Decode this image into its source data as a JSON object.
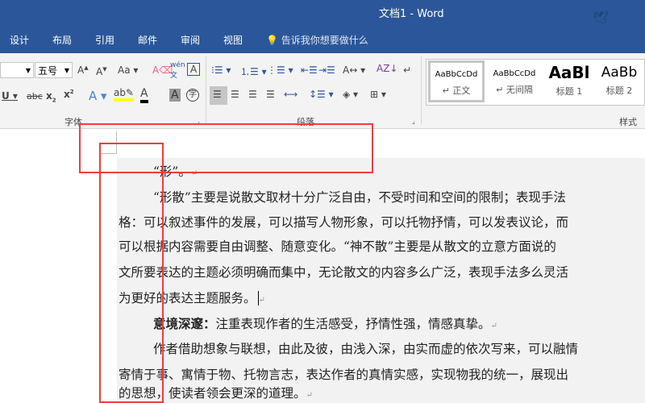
{
  "window": {
    "title": "文档1  -  Word"
  },
  "tabs": [
    "设计",
    "布局",
    "引用",
    "邮件",
    "审阅",
    "视图"
  ],
  "tell_me": "告诉我你想要做什么",
  "ribbon": {
    "font_size": "五号",
    "font_group": "字体",
    "paragraph_group": "段落",
    "styles_group": "样式",
    "styles": [
      {
        "preview": "AaBbCcDd",
        "name": "↵ 正文"
      },
      {
        "preview": "AaBbCcDd",
        "name": "↵ 无间隔"
      },
      {
        "preview": "AaBl",
        "name": "标题 1"
      },
      {
        "preview": "AaBb",
        "name": "标题 2"
      }
    ]
  },
  "document": {
    "lines": [
      "“形”。",
      "“形散”主要是说散文取材十分广泛自由，不受时间和空间的限制；表现手法",
      "格：可以叙述事件的发展，可以描写人物形象，可以托物抒情，可以发表议论，而",
      "可以根据内容需要自由调整、随意变化。“神不散”主要是从散文的立意方面说的",
      "文所要表达的主题必须明确而集中，无论散文的内容多么广泛，表现手法多么灵活",
      "为更好的表达主题服务。",
      "注重表现作者的生活感受，抒情性强，情感真挚。",
      "作者借助想象与联想，由此及彼，由浅入深，由实而虚的依次写来，可以融情",
      "寄情于事、寓情于物、托物言志，表达作者的真情实感，实现物我的统一，展现出",
      "的思想，使读者领会更深的道理。"
    ],
    "bold_label": "意境深邃：",
    "para_mark": "↵"
  }
}
